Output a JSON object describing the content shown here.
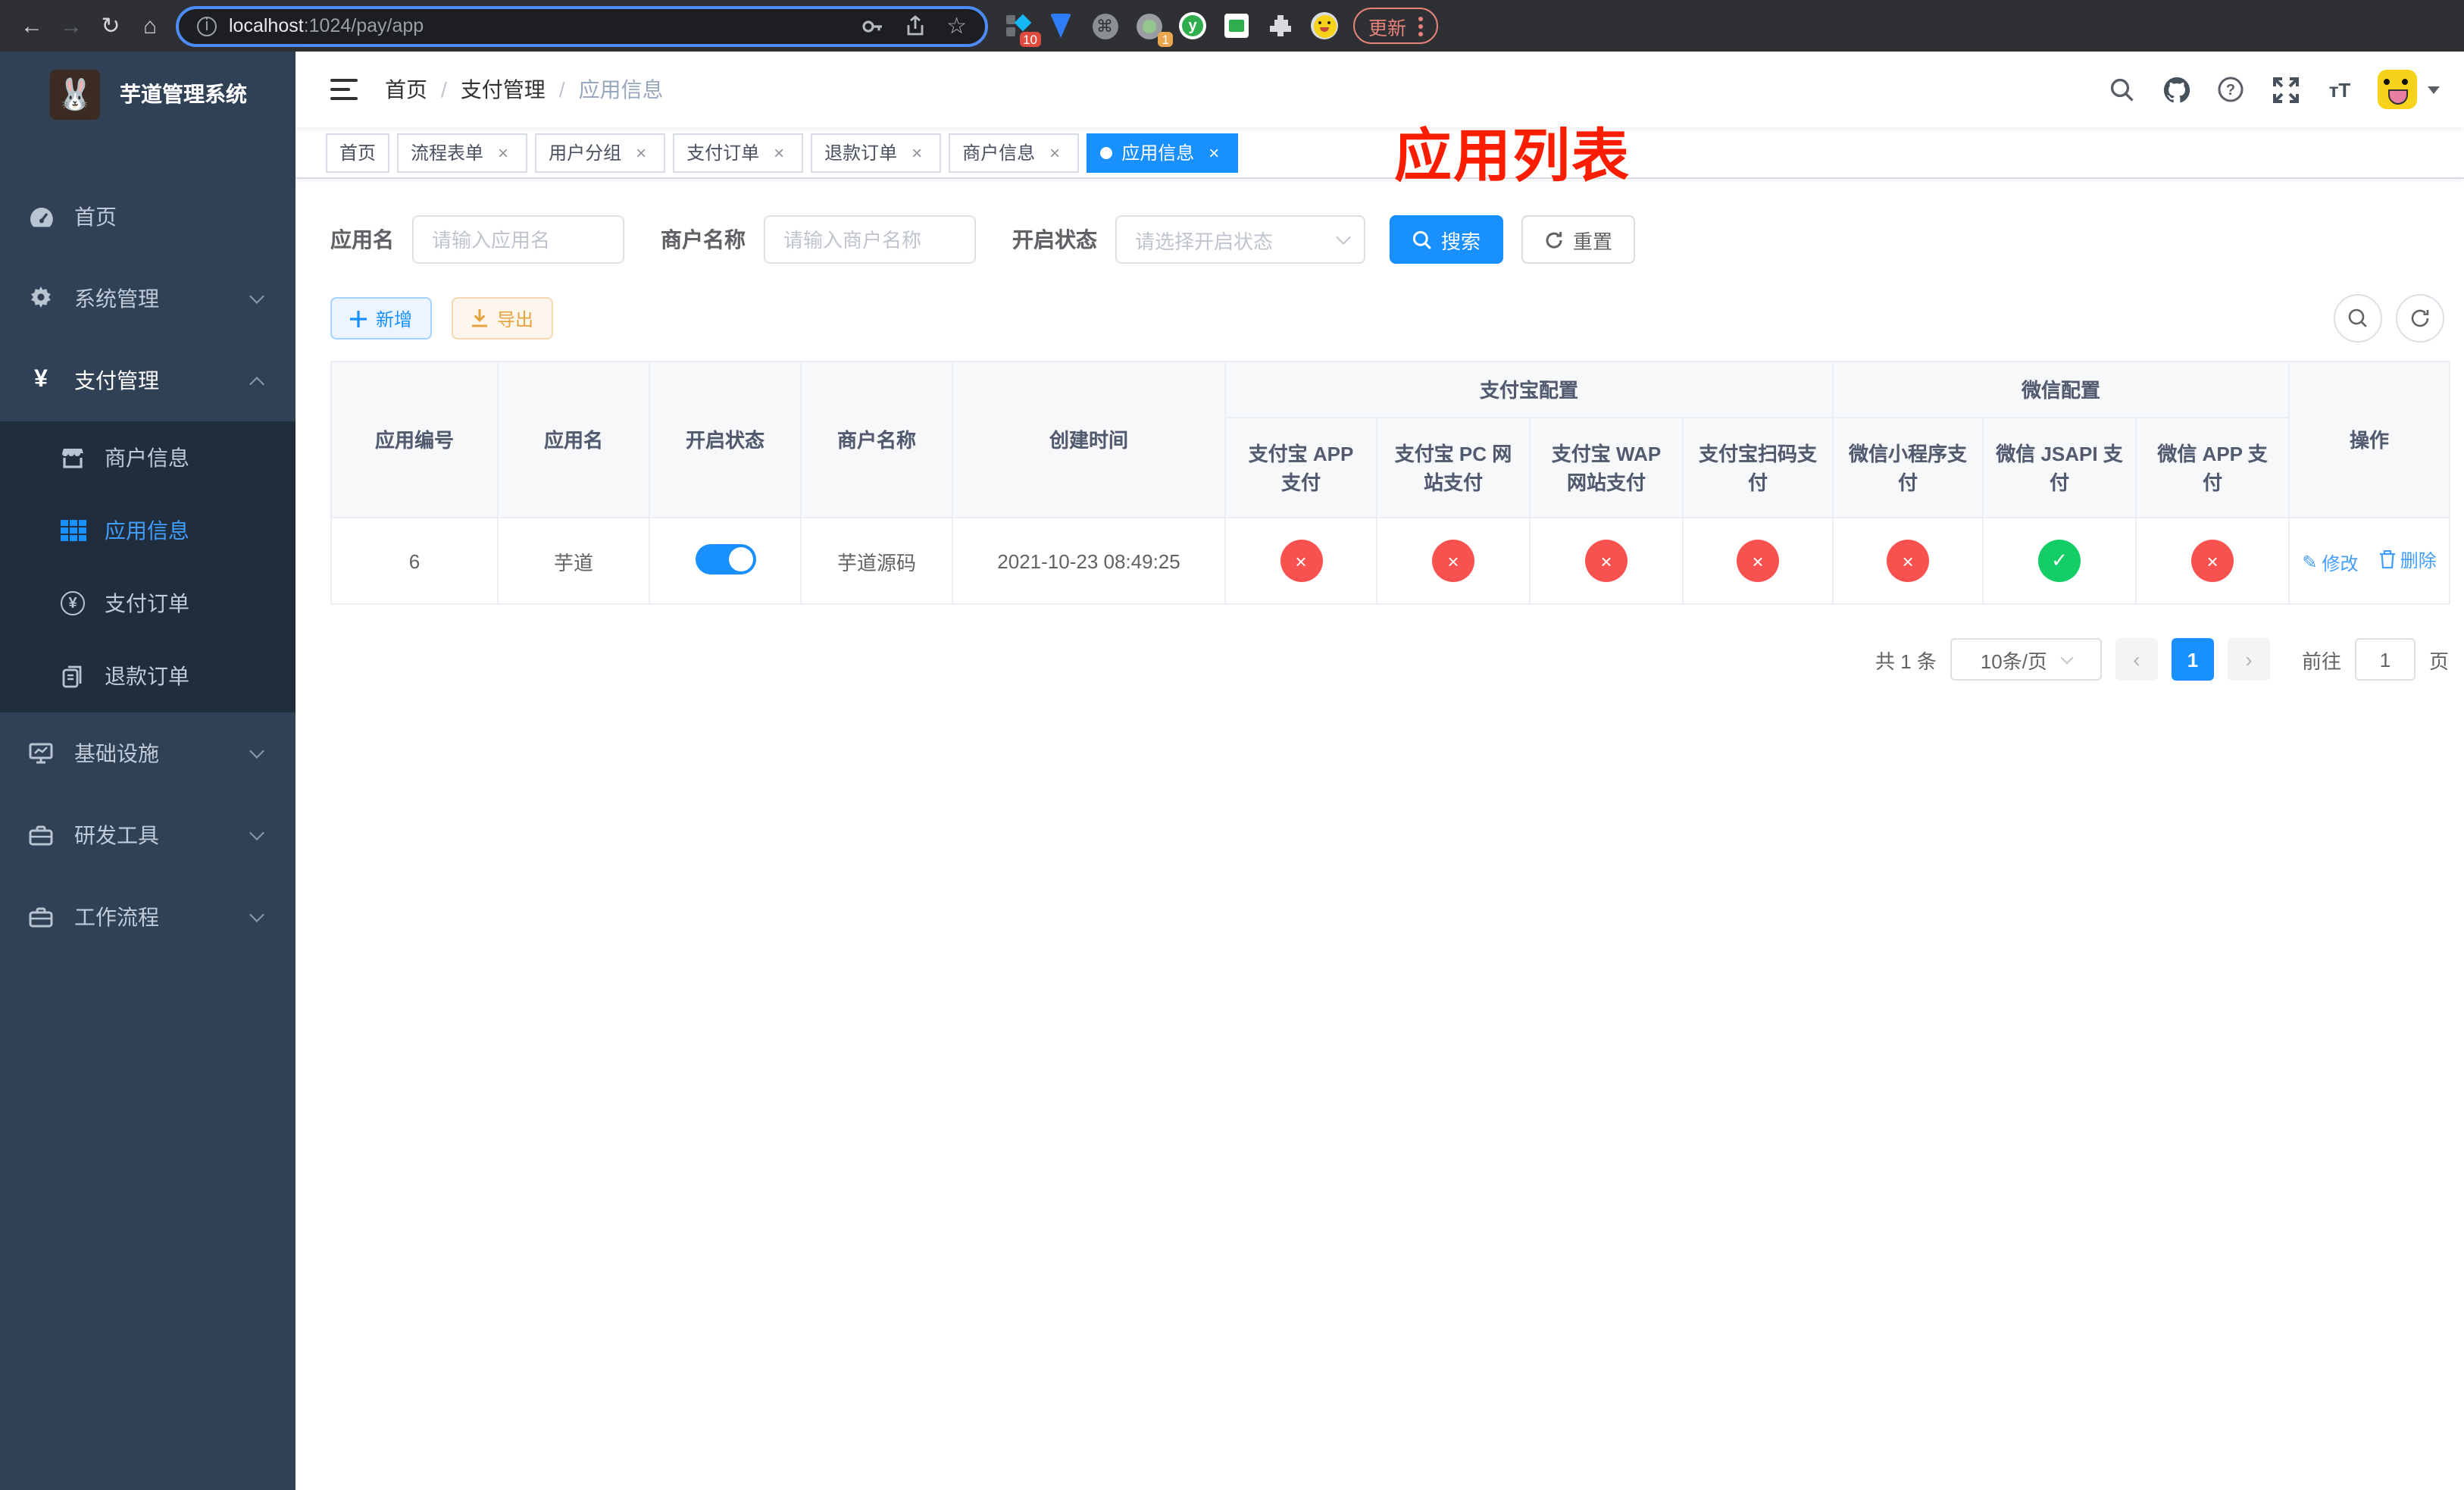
{
  "ui": {
    "close_symbol": "×",
    "breadcrumb_separator": "/",
    "prev_symbol": "‹",
    "next_symbol": "›",
    "question_mark": "?",
    "info_symbol": "i",
    "cmd_symbol": "⌘",
    "y_symbol": "y",
    "back_symbol": "←",
    "forward_symbol": "→",
    "reload_symbol": "↻",
    "home_symbol": "⌂",
    "star_symbol": "☆",
    "yen_symbol": "¥",
    "edit_symbol": "✎",
    "font_size_symbol": "тT"
  },
  "browser": {
    "url_host": "localhost",
    "url_rest": ":1024/pay/app",
    "ext_badge_1": "10",
    "ext_badge_2": "1",
    "update_label": "更新"
  },
  "annotation": {
    "title": "应用列表"
  },
  "sidebar": {
    "logo_title": "芋道管理系统",
    "items": [
      {
        "label": "首页"
      },
      {
        "label": "系统管理"
      },
      {
        "label": "支付管理"
      }
    ],
    "submenu": [
      {
        "label": "商户信息"
      },
      {
        "label": "应用信息"
      },
      {
        "label": "支付订单"
      },
      {
        "label": "退款订单"
      }
    ],
    "items2": [
      {
        "label": "基础设施"
      },
      {
        "label": "研发工具"
      },
      {
        "label": "工作流程"
      }
    ]
  },
  "breadcrumb": {
    "items": [
      "首页",
      "支付管理",
      "应用信息"
    ]
  },
  "tabs": [
    {
      "label": "首页"
    },
    {
      "label": "流程表单"
    },
    {
      "label": "用户分组"
    },
    {
      "label": "支付订单"
    },
    {
      "label": "退款订单"
    },
    {
      "label": "商户信息"
    },
    {
      "label": "应用信息"
    }
  ],
  "filters": {
    "app_name_label": "应用名",
    "app_name_placeholder": "请输入应用名",
    "merchant_label": "商户名称",
    "merchant_placeholder": "请输入商户名称",
    "status_label": "开启状态",
    "status_placeholder": "请选择开启状态",
    "search_label": "搜索",
    "reset_label": "重置"
  },
  "toolbar": {
    "add_label": "新增",
    "export_label": "导出"
  },
  "table": {
    "groups": {
      "alipay": "支付宝配置",
      "wechat": "微信配置"
    },
    "columns": [
      "应用编号",
      "应用名",
      "开启状态",
      "商户名称",
      "创建时间",
      "支付宝 APP 支付",
      "支付宝 PC 网站支付",
      "支付宝 WAP 网站支付",
      "支付宝扫码支付",
      "微信小程序支付",
      "微信 JSAPI 支付",
      "微信 APP 支付",
      "操作"
    ],
    "row": {
      "id": "6",
      "name": "芋道",
      "merchant": "芋道源码",
      "created": "2021-10-23 08:49:25",
      "pay_status": [
        {
          "sym": "×",
          "state": "off"
        },
        {
          "sym": "×",
          "state": "off"
        },
        {
          "sym": "×",
          "state": "off"
        },
        {
          "sym": "×",
          "state": "off"
        },
        {
          "sym": "×",
          "state": "off"
        },
        {
          "sym": "✓",
          "state": "on"
        },
        {
          "sym": "×",
          "state": "off"
        }
      ],
      "edit_label": "修改",
      "delete_label": "删除"
    }
  },
  "pagination": {
    "total": "共 1 条",
    "page_size": "10条/页",
    "page": "1",
    "goto_label": "前往",
    "goto_value": "1",
    "page_suffix": "页"
  }
}
